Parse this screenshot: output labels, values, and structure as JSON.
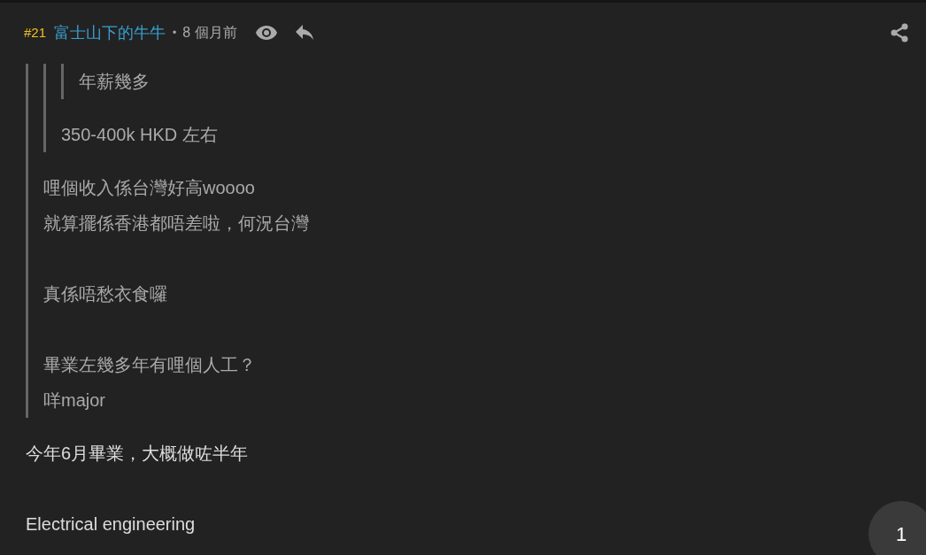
{
  "post": {
    "number": "#21",
    "author": "富士山下的牛牛",
    "separator": "•",
    "time": "8 個月前"
  },
  "body": [
    {
      "kind": "quote",
      "blocks": [
        {
          "kind": "quote",
          "blocks": [
            {
              "kind": "quote",
              "blocks": [
                {
                  "kind": "text",
                  "paragraphs": [
                    [
                      "年薪幾多"
                    ]
                  ]
                }
              ]
            },
            {
              "kind": "text",
              "paragraphs": [
                [
                  "350-400k HKD 左右"
                ]
              ]
            }
          ]
        },
        {
          "kind": "text",
          "paragraphs": [
            [
              "哩個收入係台灣好高woooo",
              "就算擺係香港都唔差啦，何況台灣"
            ],
            [
              "真係唔愁衣食囉"
            ],
            [
              "畢業左幾多年有哩個人工？",
              "咩major"
            ]
          ]
        }
      ]
    },
    {
      "kind": "text",
      "paragraphs": [
        [
          "今年6月畢業，大概做咗半年"
        ],
        [
          "Electrical engineering"
        ]
      ]
    }
  ],
  "page_button": "1"
}
